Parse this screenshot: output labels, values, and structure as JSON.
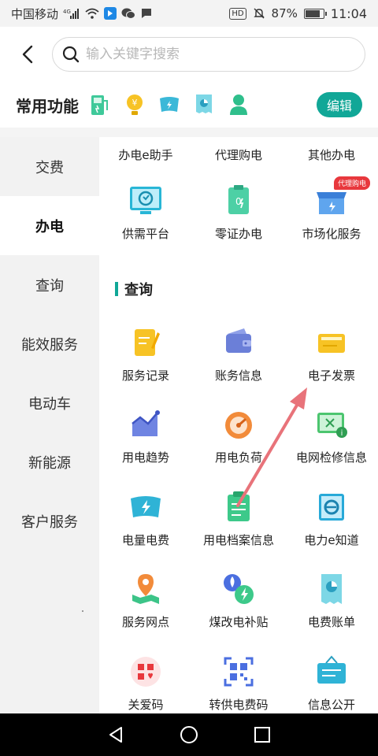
{
  "status_bar": {
    "carrier": "中国移动",
    "network": "4G",
    "hd": "HD",
    "battery_percent": "87%",
    "battery_level": 0.87,
    "time": "11:04"
  },
  "search": {
    "placeholder": "输入关键字搜索"
  },
  "favorites": {
    "title": "常用功能",
    "edit_label": "编辑",
    "icons": [
      "charging-pile-icon",
      "bulb-coin-icon",
      "lightning-card-icon",
      "pie-document-icon",
      "user-icon"
    ]
  },
  "sidebar": {
    "items": [
      {
        "label": "交费"
      },
      {
        "label": "办电"
      },
      {
        "label": "查询"
      },
      {
        "label": "能效服务"
      },
      {
        "label": "电动车"
      },
      {
        "label": "新能源"
      },
      {
        "label": "客户服务"
      }
    ],
    "active_index": 1
  },
  "content": {
    "top_partial_row": [
      {
        "label": "办电e助手"
      },
      {
        "label": "代理购电"
      },
      {
        "label": "其他办电"
      }
    ],
    "row_banDian": [
      {
        "label": "供需平台",
        "icon": "supply-demand-icon"
      },
      {
        "label": "零证办电",
        "icon": "zero-certificate-icon"
      },
      {
        "label": "市场化服务",
        "icon": "market-store-icon",
        "badge": "代理购电"
      }
    ],
    "query_section_title": "查询",
    "query_items": [
      {
        "label": "服务记录",
        "icon": "service-record-icon"
      },
      {
        "label": "账务信息",
        "icon": "wallet-icon"
      },
      {
        "label": "电子发票",
        "icon": "invoice-icon"
      },
      {
        "label": "用电趋势",
        "icon": "trend-chart-icon"
      },
      {
        "label": "用电负荷",
        "icon": "gauge-icon"
      },
      {
        "label": "电网检修信息",
        "icon": "grid-maintenance-icon"
      },
      {
        "label": "电量电费",
        "icon": "electricity-fee-icon"
      },
      {
        "label": "用电档案信息",
        "icon": "clipboard-icon"
      },
      {
        "label": "电力e知道",
        "icon": "knowledge-icon"
      },
      {
        "label": "服务网点",
        "icon": "map-pin-icon"
      },
      {
        "label": "煤改电补贴",
        "icon": "coal-to-electric-icon"
      },
      {
        "label": "电费账单",
        "icon": "bill-icon"
      },
      {
        "label": "关爱码",
        "icon": "care-code-icon"
      },
      {
        "label": "转供电费码",
        "icon": "qr-scan-icon"
      },
      {
        "label": "信息公开",
        "icon": "notice-board-icon"
      }
    ]
  },
  "colors": {
    "accent": "#11a797",
    "badge": "#e8383d",
    "arrow": "#e8737a"
  }
}
